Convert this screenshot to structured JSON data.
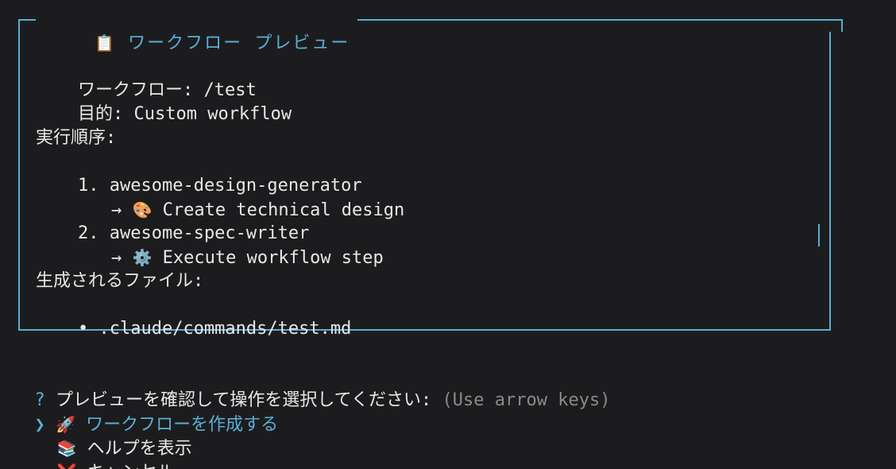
{
  "preview_box": {
    "title_icon": "📋",
    "title": "ワークフロー プレビュー",
    "workflow_label": "ワークフロー:",
    "workflow_value": "/test",
    "purpose_label": "目的:",
    "purpose_value": "Custom workflow",
    "order_heading": "実行順序:",
    "steps": [
      {
        "number": "1.",
        "name": "awesome-design-generator",
        "arrow": "→",
        "icon": "🎨",
        "description": "Create technical design"
      },
      {
        "number": "2.",
        "name": "awesome-spec-writer",
        "arrow": "→",
        "icon": "⚙️",
        "description": "Execute workflow step"
      }
    ],
    "files_heading": "生成されるファイル:",
    "files": [
      {
        "bullet": "•",
        "path": ".claude/commands/test.md"
      }
    ]
  },
  "prompt": {
    "question_mark": "?",
    "question": "プレビューを確認して操作を選択してください:",
    "hint": "(Use arrow keys)",
    "pointer": "❯",
    "options": [
      {
        "icon": "🚀",
        "label": "ワークフローを作成する",
        "selected": true
      },
      {
        "icon": "📚",
        "label": "ヘルプを表示",
        "selected": false
      },
      {
        "icon": "❌",
        "label": "キャンセル",
        "selected": false
      }
    ]
  },
  "colors": {
    "background": "#1c1c1e",
    "accent": "#5aaed6",
    "text": "#e8e8e8",
    "hint": "#8a8a8a"
  }
}
